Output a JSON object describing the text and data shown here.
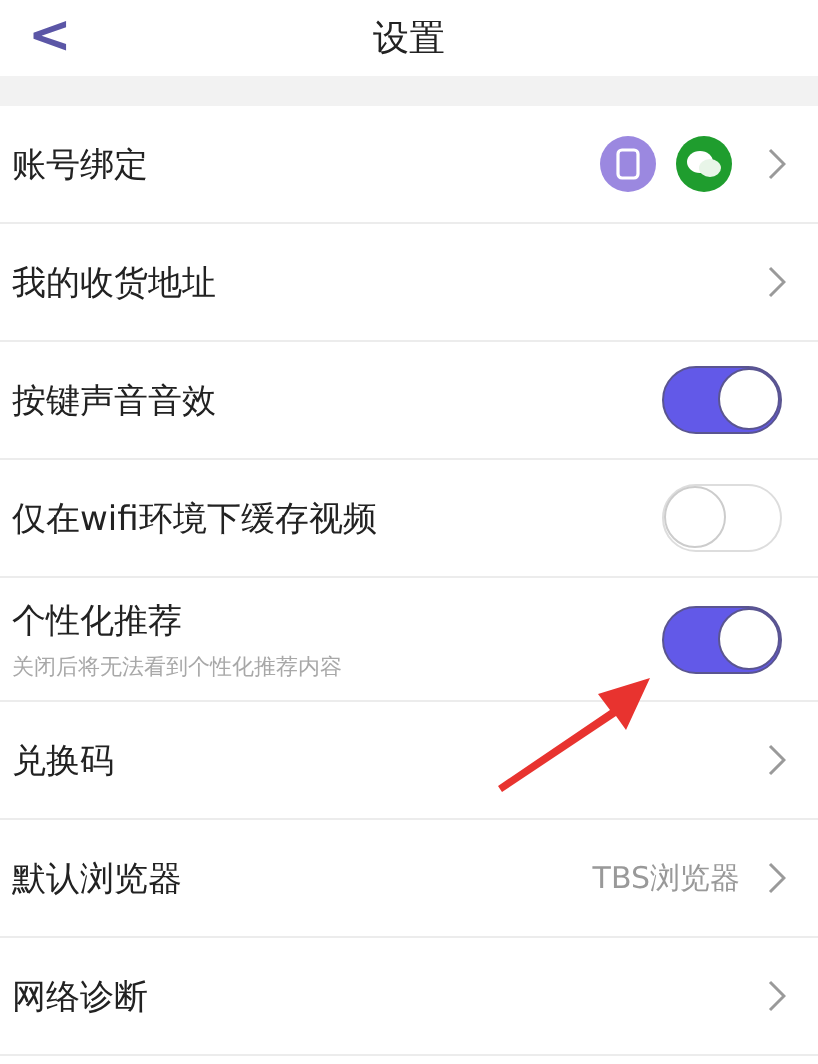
{
  "header": {
    "back": "<",
    "title": "设置"
  },
  "rows": [
    {
      "kind": "bindings",
      "label": "账号绑定"
    },
    {
      "kind": "link",
      "label": "我的收货地址"
    },
    {
      "kind": "switch",
      "label": "按键声音音效",
      "on": true
    },
    {
      "kind": "switch",
      "label": "仅在wifi环境下缓存视频",
      "on": false
    },
    {
      "kind": "switch",
      "label": "个性化推荐",
      "subtitle": "关闭后将无法看到个性化推荐内容",
      "on": true
    },
    {
      "kind": "link",
      "label": "兑换码"
    },
    {
      "kind": "link",
      "label": "默认浏览器",
      "value": "TBS浏览器"
    },
    {
      "kind": "link",
      "label": "网络诊断"
    }
  ]
}
